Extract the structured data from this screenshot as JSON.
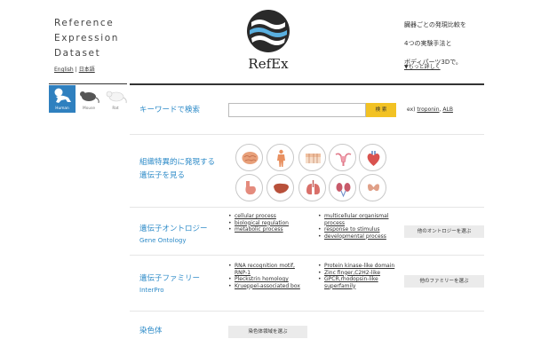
{
  "header": {
    "site_name_lines": [
      "Reference",
      "Expression",
      "Dataset"
    ],
    "lang_english": "English",
    "lang_separator": "|",
    "lang_japanese": "日本語",
    "logo_text": "RefEx",
    "tagline_lines": [
      "臓器ごとの発現比較を",
      "4つの実験手法と",
      "ボディパーツ3Dで。"
    ],
    "more_link": "▼もっと詳しく"
  },
  "species": [
    {
      "label": "Human",
      "active": true,
      "icon": "human-baby-icon"
    },
    {
      "label": "Mouse",
      "active": false,
      "icon": "mouse-icon"
    },
    {
      "label": "Rat",
      "active": false,
      "icon": "rat-icon"
    }
  ],
  "keyword": {
    "title": "キーワードで検索",
    "input_value": "",
    "button_label": "検 索",
    "example_prefix": "ex)",
    "examples": [
      "troponin",
      "ALB"
    ],
    "example_sep": ","
  },
  "tissue": {
    "title_line1": "組織特異的に発現する",
    "title_line2": "遺伝子を見る",
    "organs": [
      "brain-icon",
      "body-muscle-icon",
      "skin-icon",
      "uterus-icon",
      "heart-icon",
      "stomach-icon",
      "liver-icon",
      "lungs-icon",
      "kidneys-icon",
      "thyroid-icon"
    ]
  },
  "ontology": {
    "title": "遺伝子オントロジー",
    "subtitle": "Gene Ontology",
    "col1": [
      "cellular process",
      "biological regulation",
      "metabolic process"
    ],
    "col2": [
      "multicellular organismal process",
      "response to stimulus",
      "developmental process"
    ],
    "button": "他のオントロジーを選ぶ"
  },
  "family": {
    "title": "遺伝子ファミリー",
    "subtitle": "InterPro",
    "col1": [
      "RNA recognition motif, RNP-1",
      "Pleckstrin homology",
      "Krueppel-associated box"
    ],
    "col2": [
      "Protein kinase-like domain",
      "Zinc finger,C2H2-like",
      "GPCR,rhodopsin-like superfamily"
    ],
    "button": "他のファミリーを選ぶ"
  },
  "chromosome": {
    "title": "染色体",
    "button": "染色体領域を選ぶ"
  },
  "colors": {
    "accent_blue": "#2e8bc8",
    "search_yellow": "#f2c224",
    "active_species": "#2f80bf"
  }
}
